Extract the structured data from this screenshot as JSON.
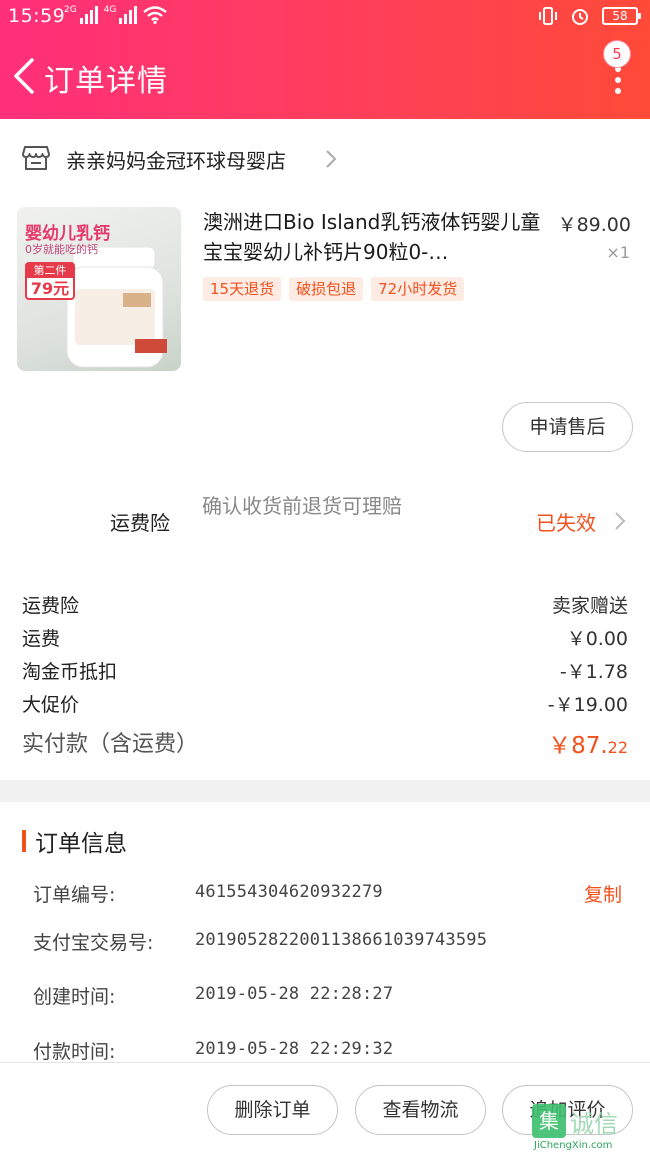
{
  "status_bar": {
    "time": "15:59",
    "net1": "2G",
    "net2": "4G",
    "battery": "58"
  },
  "header": {
    "title": "订单详情",
    "badge_count": "5"
  },
  "shop": {
    "name": "亲亲妈妈金冠环球母婴店"
  },
  "product": {
    "image_text": {
      "headline": "婴幼儿乳钙",
      "sub": "0岁就能吃的钙",
      "badge_top": "第二件",
      "badge_price": "79元"
    },
    "title": "澳洲进口Bio Island乳钙液体钙婴儿童宝宝婴幼儿补钙片90粒0-…",
    "price": "￥89.00",
    "qty": "×1",
    "tags": [
      "15天退货",
      "破损包退",
      "72小时发货"
    ],
    "after_sale_label": "申请售后"
  },
  "insurance": {
    "label": "运费险",
    "description": "确认收货前退货可理赔",
    "status": "已失效"
  },
  "costs": [
    {
      "label": "运费险",
      "value": "卖家赠送"
    },
    {
      "label": "运费",
      "value": "￥0.00"
    },
    {
      "label": "淘金币抵扣",
      "value": "-￥1.78"
    },
    {
      "label": "大促价",
      "value": "-￥19.00"
    }
  ],
  "total": {
    "label": "实付款（含运费）",
    "value_main": "￥87.",
    "value_decimal": "22"
  },
  "order_info": {
    "title": "订单信息",
    "copy_label": "复制",
    "rows": [
      {
        "label": "订单编号:",
        "value": "461554304620932279"
      },
      {
        "label": "支付宝交易号:",
        "value": "2019052822001138661039743595"
      },
      {
        "label": "创建时间:",
        "value": "2019-05-28 22:28:27"
      },
      {
        "label": "付款时间:",
        "value": "2019-05-28 22:29:32"
      }
    ]
  },
  "actions": {
    "delete": "删除订单",
    "logistics": "查看物流",
    "review": "追加评价"
  },
  "watermark": {
    "logo_char": "集",
    "text": "诚信",
    "url": "JiChengXin.com"
  },
  "colors": {
    "header_start": "#ff2f7a",
    "header_end": "#ff4a38",
    "accent": "#f2511c"
  }
}
